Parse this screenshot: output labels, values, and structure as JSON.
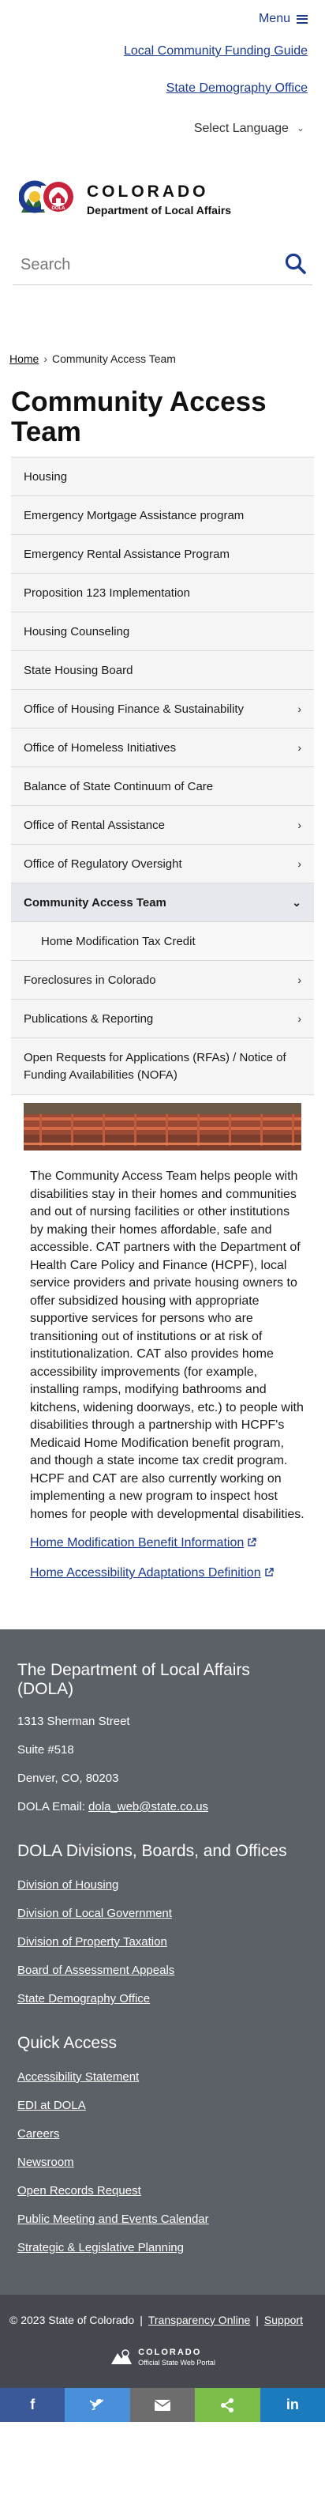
{
  "header": {
    "menu_label": "Menu",
    "util_links": [
      "Local Community Funding Guide",
      "State Demography Office"
    ],
    "language_label": "Select Language"
  },
  "logo": {
    "title": "COLORADO",
    "subtitle": "Department of Local Affairs",
    "badge": "DOLA"
  },
  "search": {
    "placeholder": "Search"
  },
  "breadcrumb": {
    "home": "Home",
    "separator": "›",
    "current": "Community Access Team"
  },
  "page_title": "Community Access Team",
  "nav": [
    {
      "label": "Housing",
      "arrow": ""
    },
    {
      "label": "Emergency Mortgage Assistance program",
      "arrow": ""
    },
    {
      "label": "Emergency Rental Assistance Program",
      "arrow": ""
    },
    {
      "label": "Proposition 123 Implementation",
      "arrow": ""
    },
    {
      "label": "Housing Counseling",
      "arrow": ""
    },
    {
      "label": "State Housing Board",
      "arrow": ""
    },
    {
      "label": "Office of Housing Finance & Sustainability",
      "arrow": "›"
    },
    {
      "label": "Office of Homeless Initiatives",
      "arrow": "›"
    },
    {
      "label": "Balance of State Continuum of Care",
      "arrow": ""
    },
    {
      "label": "Office of Rental Assistance",
      "arrow": "›"
    },
    {
      "label": "Office of Regulatory Oversight",
      "arrow": "›"
    },
    {
      "label": "Community Access Team",
      "arrow": "⌄"
    },
    {
      "label": "Home Modification Tax Credit",
      "arrow": ""
    },
    {
      "label": "Foreclosures in Colorado",
      "arrow": "›"
    },
    {
      "label": "Publications & Reporting",
      "arrow": "›"
    },
    {
      "label": "Open Requests for Applications (RFAs) / Notice of Funding Availabilities (NOFA)",
      "arrow": ""
    }
  ],
  "body_text": "The Community Access Team helps people with disabilities stay in their homes and communities and out of nursing facilities or other institutions by making their homes affordable, safe and accessible.  CAT partners with the Department of Health Care Policy and Finance (HCPF), local service providers and private housing owners to offer subsidized housing with appropriate supportive services for persons who are transitioning out of institutions or at risk of institutionalization.  CAT also provides home accessibility improvements (for example, installing ramps, modifying bathrooms and kitchens, widening doorways, etc.) to people with disabilities through a partnership with HCPF's Medicaid Home Modification benefit program, and though a state income tax credit program.  HCPF and CAT are also currently working on implementing a new program to inspect host homes for people with developmental disabilities.",
  "links": [
    "Home Modification Benefit Information",
    "Home Accessibility Adaptations Definition"
  ],
  "footer": {
    "org_title": "The Department of Local Affairs (DOLA)",
    "address1": "1313 Sherman Street",
    "address2": "Suite  #518",
    "address3": "Denver, CO, 80203",
    "email_label": "DOLA Email:",
    "email": "dola_web@state.co.us",
    "divisions_title": "DOLA Divisions, Boards, and Offices",
    "divisions": [
      "Division of Housing",
      "Division of Local Government",
      "Division of Property Taxation",
      "Board of Assessment Appeals",
      "State Demography Office"
    ],
    "quick_title": "Quick Access",
    "quick": [
      "Accessibility Statement",
      "EDI at DOLA",
      "Careers",
      "Newsroom",
      "Open Records Request",
      "Public Meeting and Events Calendar",
      "Strategic & Legislative Planning"
    ]
  },
  "footer_bottom": {
    "copyright": "© 2023 State of Colorado",
    "transparency": "Transparency Online",
    "support": "Support",
    "logo_title": "COLORADO",
    "logo_sub": "Official State Web Portal"
  },
  "share": {
    "facebook": "f",
    "twitter": "twitter-icon",
    "email": "email-icon",
    "share": "share-icon",
    "linkedin": "in",
    "colors": [
      "#3b5998",
      "#4a8fd9",
      "#6d6d6d",
      "#7bbf4a",
      "#1c7bbd"
    ]
  },
  "colors": {
    "link": "#1a3a8f",
    "footer_bg": "#5c6168",
    "footer_bottom_bg": "#45494f",
    "active_nav": "#e6e8ee"
  }
}
